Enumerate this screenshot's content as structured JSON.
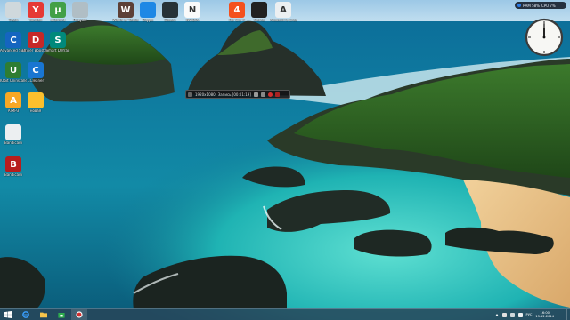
{
  "desktop": {
    "icons_top": [
      {
        "name": "trash-icon",
        "label": "Trash",
        "glyph": "",
        "color": "#cfd8dc"
      },
      {
        "name": "yandex-icon",
        "label": "Yandex",
        "glyph": "Y",
        "color": "#e53935"
      },
      {
        "name": "utorrent-icon",
        "label": "uTorrent",
        "glyph": "µ",
        "color": "#43a047"
      },
      {
        "name": "file-icon",
        "label": "Recycle",
        "glyph": "",
        "color": "#b0bec5"
      },
      {
        "name": "world-of-tanks-icon",
        "label": "World of Tanks",
        "glyph": "W",
        "color": "#5d4037"
      },
      {
        "name": "skype-icon",
        "label": "Skype",
        "glyph": "",
        "color": "#1e88e5"
      },
      {
        "name": "steam-icon",
        "label": "Steam",
        "glyph": "",
        "color": "#263238"
      },
      {
        "name": "nvidia-icon",
        "label": "NVIDIA",
        "glyph": "N",
        "color": "#fafafa"
      },
      {
        "name": "game-4-icon",
        "label": "Far Cry 4",
        "glyph": "4",
        "color": "#f4511e"
      },
      {
        "name": "game-dark-icon",
        "label": "Game",
        "glyph": "",
        "color": "#212121"
      },
      {
        "name": "assassins-creed-icon",
        "label": "Assassin's Creed",
        "glyph": "A",
        "color": "#eceff1"
      }
    ],
    "icons_left": [
      {
        "name": "advanced-systemcare-icon",
        "label": "Advanced SystemCare 8",
        "glyph": "C",
        "color": "#1565c0"
      },
      {
        "name": "driver-booster-icon",
        "label": "Driver Booster 2",
        "glyph": "D",
        "color": "#c62828"
      },
      {
        "name": "smart-defrag-icon",
        "label": "Smart Defrag",
        "glyph": "S",
        "color": "#00897b"
      },
      {
        "name": "iobit-uninstaller-icon",
        "label": "IObit Uninstaller",
        "glyph": "U",
        "color": "#2e7d32"
      },
      {
        "name": "ccleaner-icon",
        "label": "CCleaner",
        "glyph": "C",
        "color": "#1976d2"
      },
      {
        "name": "aimp-icon",
        "label": "AIMP3",
        "glyph": "A",
        "color": "#f9a825"
      },
      {
        "name": "folder-icon",
        "label": "новая",
        "glyph": "",
        "color": "#fbc02d"
      },
      {
        "name": "bandicam-file-icon",
        "label": "Bandicam",
        "glyph": "",
        "color": "#eceff1"
      },
      {
        "name": "bandicam-icon",
        "label": "Bandicam",
        "glyph": "B",
        "color": "#b71c1c"
      }
    ]
  },
  "sysmon": {
    "ram": "RAM 58%",
    "cpu": "CPU 7%"
  },
  "recorder": {
    "resolution": "1920x1080",
    "status": "Запись [00:01:19]"
  },
  "taskbar": {
    "buttons": [
      {
        "name": "start-button",
        "icon": "windows-icon"
      },
      {
        "name": "ie-button",
        "icon": "ie-icon"
      },
      {
        "name": "explorer-button",
        "icon": "folder-icon"
      },
      {
        "name": "store-button",
        "icon": "store-icon"
      },
      {
        "name": "bandicam-task-button",
        "icon": "record-icon"
      }
    ],
    "lang": "РУС",
    "time": "16:00",
    "date": "15.12.2014"
  },
  "colors": {
    "sea": "#0f6d8a",
    "lagoon": "#1fb3b3",
    "sand": "#e9c48b",
    "rock": "#2b3a2f",
    "taskbar": "#28465a",
    "accent": "#2c7be5"
  }
}
